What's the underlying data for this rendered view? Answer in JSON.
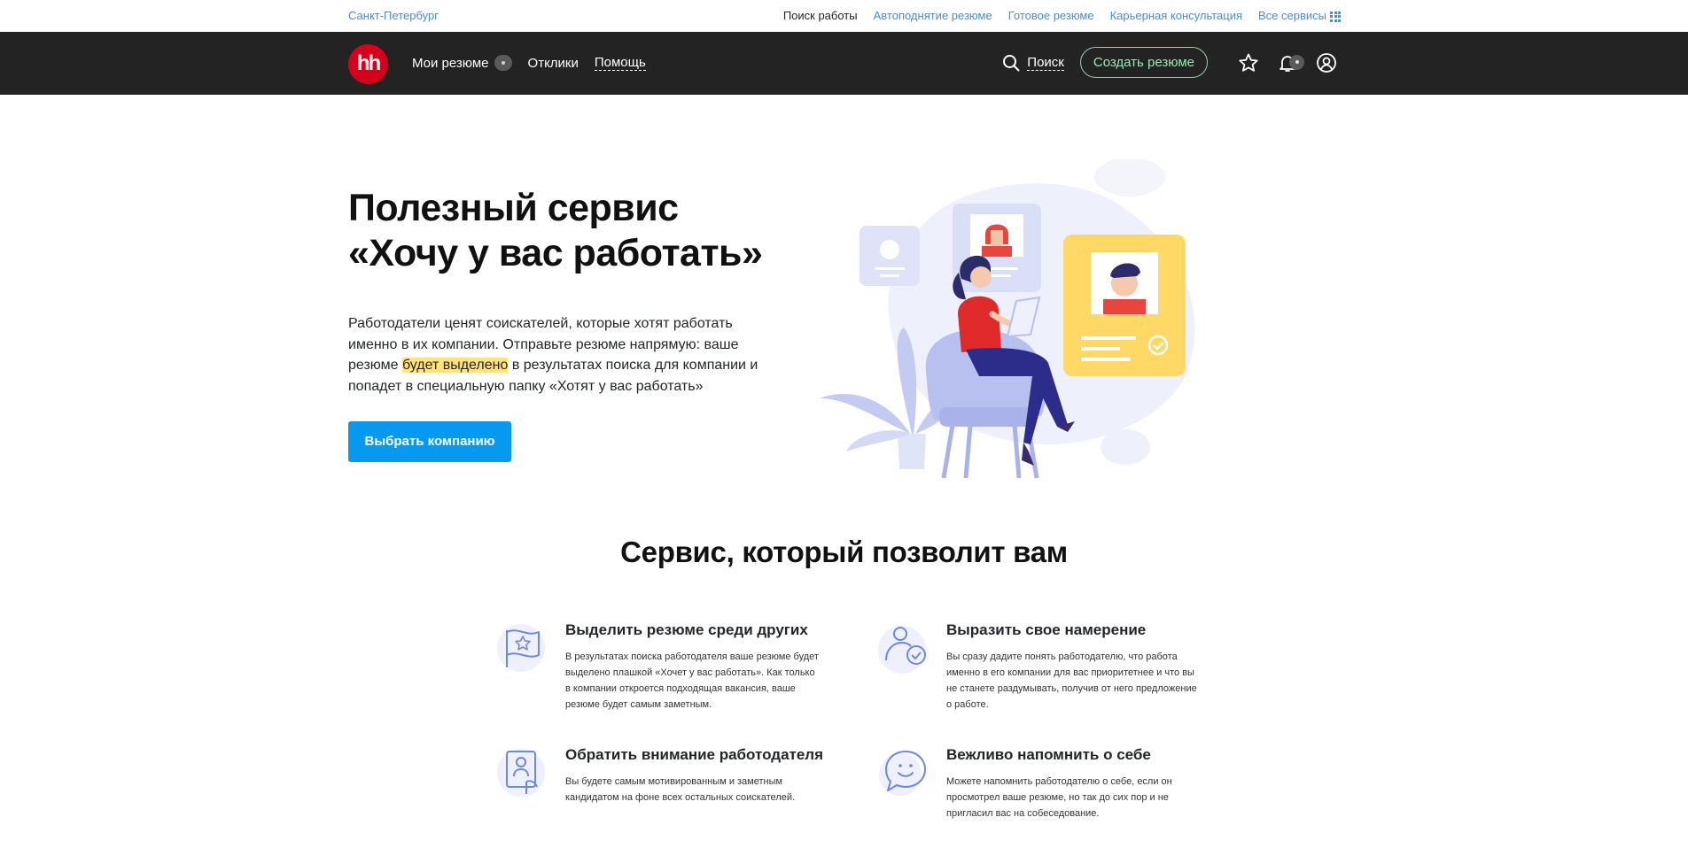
{
  "topbar": {
    "city": "Санкт-Петербург",
    "links": [
      "Поиск работы",
      "Автоподнятие резюме",
      "Готовое резюме",
      "Карьерная консультация",
      "Все сервисы"
    ]
  },
  "header": {
    "logo": "hh",
    "nav": {
      "my_resumes": "Мои резюме",
      "responses": "Отклики",
      "help": "Помощь"
    },
    "search_label": "Поиск",
    "create_resume": "Создать резюме"
  },
  "hero": {
    "title_line1": "Полезный сервис",
    "title_line2": "«Хочу у вас работать»",
    "text_before": "Работодатели ценят соискателей, которые хотят работать именно в их компании. Отправьте резюме напрямую: ваше резюме ",
    "text_highlight": "будет выделено",
    "text_after": " в результатах поиска для компании и попадет в специальную папку «Хотят у вас работать»",
    "button": "Выбрать компанию"
  },
  "features": {
    "title": "Сервис, который позволит вам",
    "items": [
      {
        "title": "Выделить резюме среди других",
        "text": "В результатах поиска работодателя ваше резюме будет выделено плашкой «Хочет у вас работать». Как только в компании откроется подходящая вакансия, ваше резюме будет самым заметным.",
        "icon": "flag-star-icon"
      },
      {
        "title": "Выразить свое намерение",
        "text": "Вы сразу дадите понять работодателю, что работа именно в его компании для вас приоритетнее и что вы не станете раздумывать, получив от него предложение о работе.",
        "icon": "person-check-icon"
      },
      {
        "title": "Обратить внимание работодателя",
        "text": "Вы будете самым мотивированным и заметным кандидатом на фоне всех остальных соискателей.",
        "icon": "person-frame-icon"
      },
      {
        "title": "Вежливо напомнить о себе",
        "text": "Можете напомнить работодателю о себе, если он просмотрел ваше резюме, но так до сих пор и не пригласил вас на собеседование.",
        "icon": "smile-chat-icon"
      }
    ]
  },
  "colors": {
    "header_bg": "#232323",
    "logo_red": "#d6001c",
    "primary_blue": "#0599f0",
    "link_blue": "#4a8ecb",
    "highlight": "#ffe27a",
    "create_green": "#9be7b3"
  }
}
